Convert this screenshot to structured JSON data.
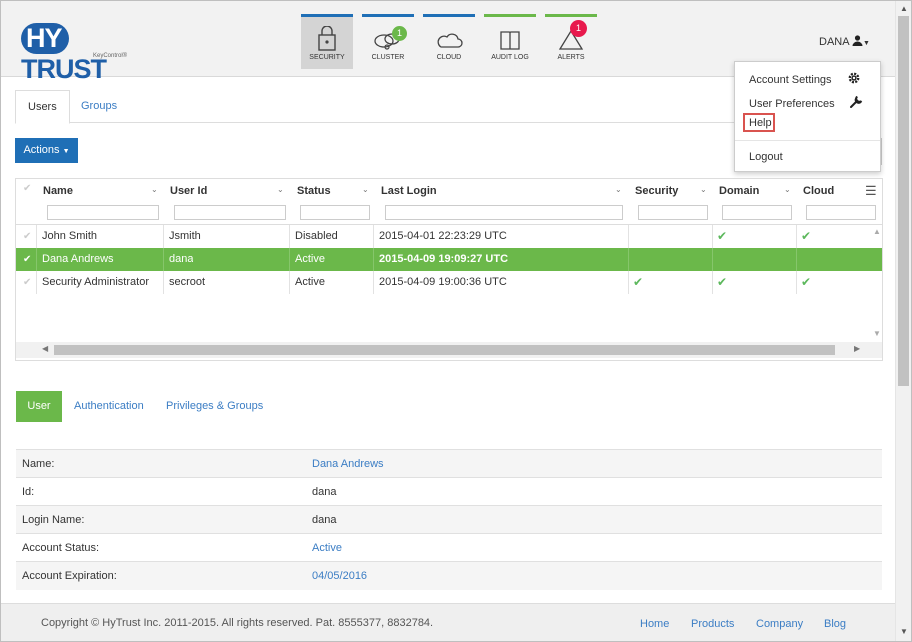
{
  "brand": {
    "logo_hy": "HY",
    "logo_rest": "TRUST",
    "subtitle": "KeyControl®"
  },
  "nav": [
    {
      "label": "SECURITY",
      "icon": "lock-icon",
      "bar_color": "#1f6fb6"
    },
    {
      "label": "CLUSTER",
      "icon": "cluster-icon",
      "bar_color": "#1f6fb6",
      "badge": "1",
      "badge_color": "#6bb84a"
    },
    {
      "label": "CLOUD",
      "icon": "cloud-icon",
      "bar_color": "#1f6fb6"
    },
    {
      "label": "AUDIT LOG",
      "icon": "book-icon",
      "bar_color": "#6bb84a"
    },
    {
      "label": "ALERTS",
      "icon": "warning-icon",
      "bar_color": "#6bb84a",
      "badge": "1",
      "badge_color": "#e8194d"
    }
  ],
  "user_menu": {
    "name": "DANA"
  },
  "dropdown": {
    "account_settings": "Account Settings",
    "user_preferences": "User Preferences",
    "help": "Help",
    "logout": "Logout"
  },
  "tabs": {
    "users": "Users",
    "groups": "Groups"
  },
  "actions_label": "Actions",
  "grid": {
    "columns": [
      "Name",
      "User Id",
      "Status",
      "Last Login",
      "Security",
      "Domain",
      "Cloud"
    ],
    "rows": [
      {
        "name": "John Smith",
        "user_id": "Jsmith",
        "status": "Disabled",
        "last_login": "2015-04-01 22:23:29 UTC",
        "security": false,
        "domain": true,
        "cloud": true,
        "selected": false
      },
      {
        "name": "Dana Andrews",
        "user_id": "dana",
        "status": "Active",
        "last_login": "2015-04-09 19:09:27 UTC",
        "security": false,
        "domain": false,
        "cloud": false,
        "selected": true
      },
      {
        "name": "Security Administrator",
        "user_id": "secroot",
        "status": "Active",
        "last_login": "2015-04-09 19:00:36 UTC",
        "security": true,
        "domain": true,
        "cloud": true,
        "selected": false
      }
    ]
  },
  "detail_tabs": {
    "user": "User",
    "authentication": "Authentication",
    "privileges": "Privileges & Groups"
  },
  "details": [
    {
      "label": "Name:",
      "value": "Dana Andrews",
      "link": true
    },
    {
      "label": "Id:",
      "value": "dana",
      "link": false
    },
    {
      "label": "Login Name:",
      "value": "dana",
      "link": false
    },
    {
      "label": "Account Status:",
      "value": "Active",
      "link": true
    },
    {
      "label": "Account Expiration:",
      "value": "04/05/2016",
      "link": true
    }
  ],
  "footer": {
    "copyright": "Copyright © HyTrust Inc. 2011-2015. All rights reserved. Pat. 8555377, 8832784.",
    "links": [
      "Home",
      "Products",
      "Company",
      "Blog"
    ]
  }
}
